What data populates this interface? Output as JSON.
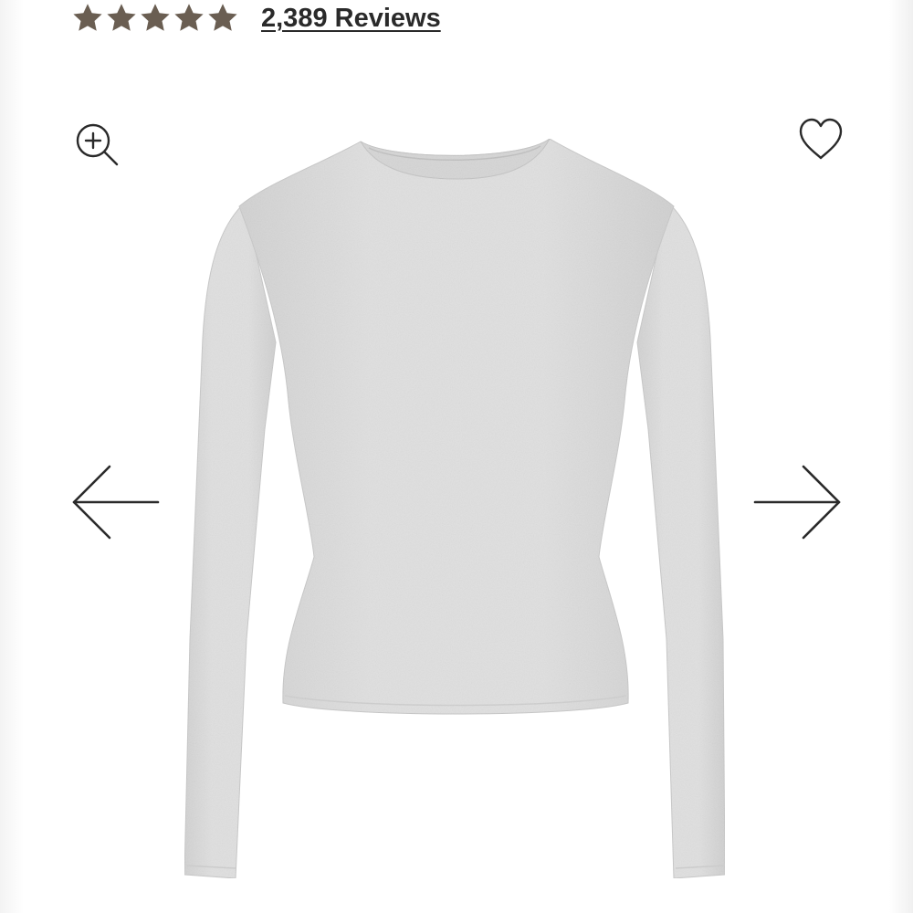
{
  "rating": {
    "stars": 5,
    "star_color": "#6a5e52",
    "reviews_label": "2,389 Reviews"
  },
  "icons": {
    "zoom": "zoom-in-icon",
    "wishlist": "heart-icon",
    "previous": "arrow-left-icon",
    "next": "arrow-right-icon"
  },
  "product": {
    "garment_color": "#dcdcdc"
  }
}
